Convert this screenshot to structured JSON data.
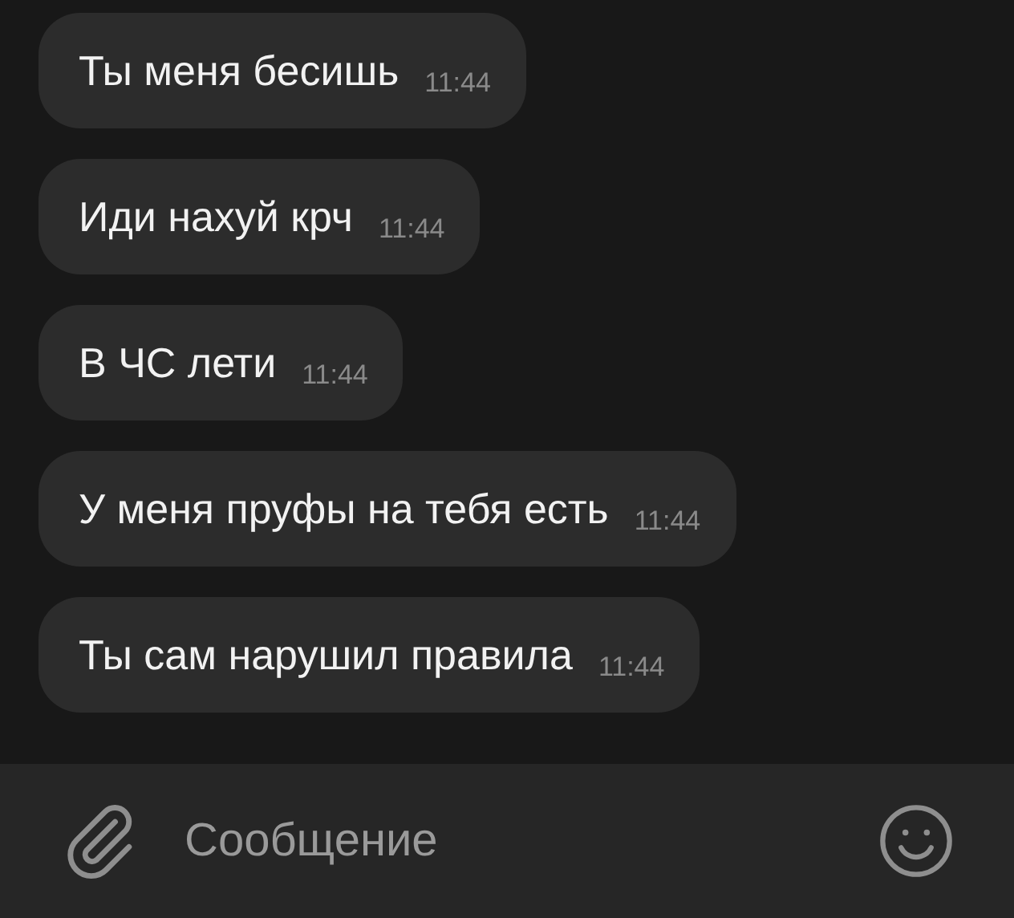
{
  "messages": [
    {
      "text": "Ты меня бесишь",
      "time": "11:44"
    },
    {
      "text": "Иди нахуй крч",
      "time": "11:44"
    },
    {
      "text": "В ЧС лети",
      "time": "11:44"
    },
    {
      "text": "У меня пруфы на тебя есть",
      "time": "11:44"
    },
    {
      "text": "Ты сам нарушил правила",
      "time": "11:44"
    }
  ],
  "composer": {
    "placeholder": "Сообщение"
  }
}
